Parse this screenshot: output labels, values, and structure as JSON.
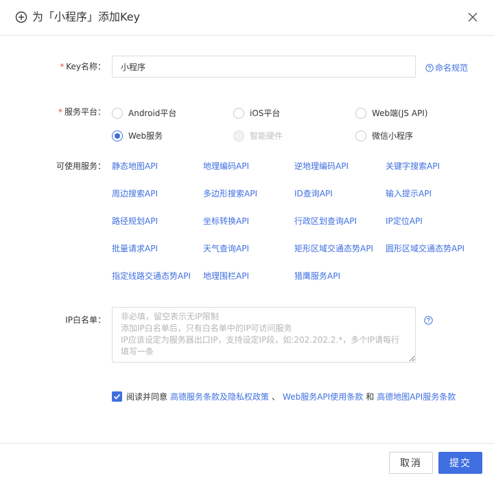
{
  "header": {
    "title": "为「小程序」添加Key"
  },
  "form": {
    "key_name": {
      "required_mark": "*",
      "label": "Key名称：",
      "value": "小程序",
      "help_link": "命名规范"
    },
    "platform": {
      "required_mark": "*",
      "label": "服务平台：",
      "options": [
        {
          "label": "Android平台",
          "checked": false,
          "disabled": false
        },
        {
          "label": "iOS平台",
          "checked": false,
          "disabled": false
        },
        {
          "label": "Web端(JS API)",
          "checked": false,
          "disabled": false
        },
        {
          "label": "Web服务",
          "checked": true,
          "disabled": false
        },
        {
          "label": "智能硬件",
          "checked": false,
          "disabled": true
        },
        {
          "label": "微信小程序",
          "checked": false,
          "disabled": false
        }
      ]
    },
    "services": {
      "label": "可使用服务：",
      "items": [
        "静态地图API",
        "地理编码API",
        "逆地理编码API",
        "关键字搜索API",
        "周边搜索API",
        "多边形搜索API",
        "ID查询API",
        "输入提示API",
        "路径规划API",
        "坐标转换API",
        "行政区划查询API",
        "IP定位API",
        "批量请求API",
        "天气查询API",
        "矩形区域交通态势API",
        "圆形区域交通态势API",
        "指定线路交通态势API",
        "地理围栏API",
        "猎鹰服务API"
      ]
    },
    "ip_whitelist": {
      "label": "IP白名单：",
      "placeholder": "非必填，留空表示无IP限制\n添加IP白名单后，只有白名单中的IP可访问服务\nIP应该设定为服务器出口IP，支持设定IP段，如:202.202.2.*，多个IP请每行填写一条"
    },
    "agreement": {
      "checked": true,
      "prefix": "阅读并同意",
      "link1": "高德服务条款及隐私权政策",
      "sep1": "、",
      "link2": "Web服务API使用条款",
      "sep2": "和",
      "link3": "高德地图API服务条款"
    }
  },
  "footer": {
    "cancel_label": "取消",
    "submit_label": "提交"
  },
  "colors": {
    "accent": "#3f6fe0",
    "required": "#e5483f"
  }
}
